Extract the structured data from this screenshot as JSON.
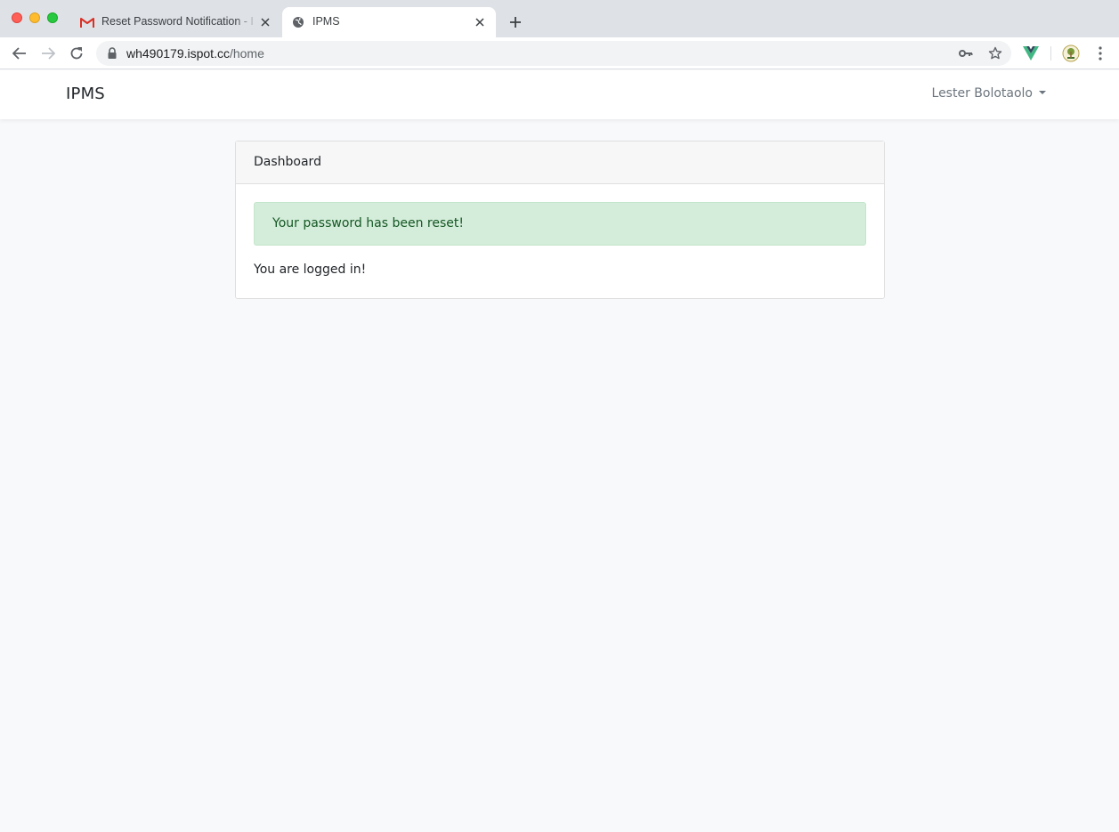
{
  "browser": {
    "tabs": [
      {
        "title": "Reset Password Notification - I",
        "icon": "gmail-icon",
        "active": false
      },
      {
        "title": "IPMS",
        "icon": "globe-icon",
        "active": true
      }
    ],
    "url": {
      "host": "wh490179.ispot.cc",
      "path": "/home"
    }
  },
  "navbar": {
    "brand": "IPMS",
    "user_name": "Lester Bolotaolo"
  },
  "card": {
    "header": "Dashboard",
    "alert_message": "Your password has been reset!",
    "body_text": "You are logged in!"
  },
  "colors": {
    "alert_bg": "#d4edda",
    "alert_text": "#155724",
    "page_bg": "#f8f9fb"
  }
}
